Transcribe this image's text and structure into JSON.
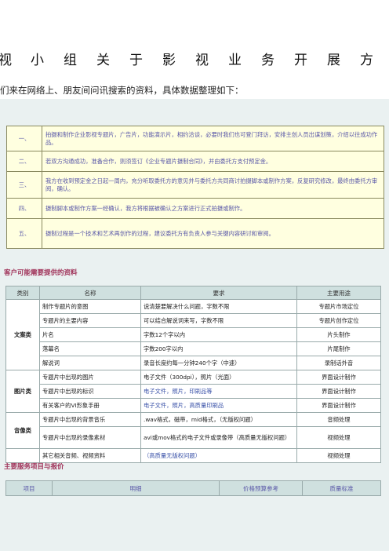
{
  "title_chars": [
    "视",
    "小",
    "组",
    "关",
    "于",
    "影",
    "视",
    "业",
    "务",
    "开",
    "展",
    "方"
  ],
  "intro": "们来在网络上、朋友间问讯搜索的资料，具体数据整理如下：",
  "process": [
    {
      "num": "一、",
      "text": "拍摄和制作企业影视专题片，广告片，功能演示片，相约洽谈，必要时我们也可登门拜访，安排主创人员出谋划策，介绍以往成功作品。"
    },
    {
      "num": "二、",
      "text": "若双方沟通成功，准备合作，则须签订《企业专题片摄制合同》，并由委托方支付预定金。"
    },
    {
      "num": "三、",
      "text": "我方在收到预定金之日起一周内，充分听取委托方的意见并与委托方共同商讨拍摄脚本或制作方案，反复研究修改，最终由委托方审阅，确认。"
    },
    {
      "num": "四、",
      "text": "摄制脚本或制作方案一经确认，我方将根据被确认之方案进行正式拍摄或制作。"
    },
    {
      "num": "五、",
      "text": "摄制过程是一个技术和艺术再创作的过程，建议委托方有负责人参与关键内容研讨和审阅。"
    }
  ],
  "materials_title": "客户可能需要提供的资料",
  "materials_headers": [
    "类别",
    "名称",
    "要求",
    "主要用途"
  ],
  "materials": [
    {
      "category": "文案类",
      "rows": [
        {
          "name": "制作专题片的意图",
          "req": "说清楚要解决什么问题，字数不限",
          "use": "专题片市场定位"
        },
        {
          "name": "专题片的主要内容",
          "req": "可以结合解说词来写，字数不限",
          "use": "专题片创作定位"
        },
        {
          "name": "片名",
          "req": "字数12个字以内",
          "use": "片头制作"
        },
        {
          "name": "落幕名",
          "req": "字数200字以内",
          "use": "片尾制作"
        },
        {
          "name": "解说词",
          "req": "录音长度约每一分钟240个字（中速）",
          "use": "录制话外音"
        }
      ]
    },
    {
      "category": "图片类",
      "rows": [
        {
          "name": "专题片中出现的图片",
          "req": "电子文件（300dpi），照片（光面）",
          "use": "界面设计制作"
        },
        {
          "name": "专题片中出现的标识",
          "req": "电子文件，照片，印刷品等",
          "use": "界面设计制作"
        },
        {
          "name": "有关客户的VI形象手册",
          "req": "电子文件，照片，高质量印刷品",
          "use": "界面设计制作"
        }
      ]
    },
    {
      "category": "音像类",
      "rows": [
        {
          "name": "专题片中出现的背景音乐",
          "req": ".wav格式，磁带，mid格式，（无版权问题）",
          "use": "音频处理"
        },
        {
          "name": "专题片中出现的录像素材",
          "req": "avi或mov格式的电子文件或录像带（高质量无版权问题）",
          "use": "视频处理"
        }
      ]
    },
    {
      "category": "",
      "rows": [
        {
          "name": "其它相关音频、视频资料",
          "req": "（高质量无版权问题）",
          "use": "视频处理"
        }
      ]
    }
  ],
  "services_title": "主要服务项目与报价",
  "services_headers": [
    "项目",
    "明细",
    "价格预算参考",
    "质量标准"
  ],
  "colors": {
    "panel": "#eaf1f1",
    "process_bg": "#ffffe0",
    "header_bg": "#cfe0df",
    "section_title": "#a0335a",
    "link_text": "#3a52a8"
  }
}
